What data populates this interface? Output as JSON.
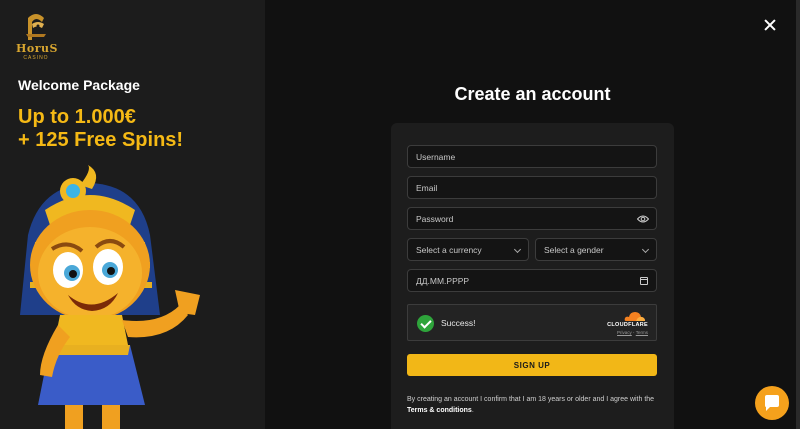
{
  "brand": {
    "name": "HoruS",
    "sub": "CASINO"
  },
  "promo": {
    "welcome": "Welcome Package",
    "line1": "Up to 1.000€",
    "line2": "+ 125 Free Spins!"
  },
  "form": {
    "title": "Create an account",
    "username_placeholder": "Username",
    "email_placeholder": "Email",
    "password_placeholder": "Password",
    "currency_placeholder": "Select a currency",
    "gender_placeholder": "Select a gender",
    "date_placeholder": "ДД.ММ.РРРР",
    "captcha": {
      "status": "Success!",
      "provider": "CLOUDFLARE",
      "privacy": "Privacy",
      "separator": "·",
      "terms": "Terms"
    },
    "signup_label": "SIGN UP",
    "terms_text": "By creating an account I confirm that I am 18 years or older and I agree with the",
    "terms_link": "Terms & conditions",
    "terms_end": "."
  },
  "colors": {
    "accent": "#f2b717",
    "success": "#2ea43b",
    "chat": "#f5a11c"
  },
  "icons": [
    "close-icon",
    "eye-icon",
    "chevron-down-icon",
    "calendar-icon",
    "checkmark-icon",
    "cloudflare-icon",
    "chat-icon"
  ]
}
